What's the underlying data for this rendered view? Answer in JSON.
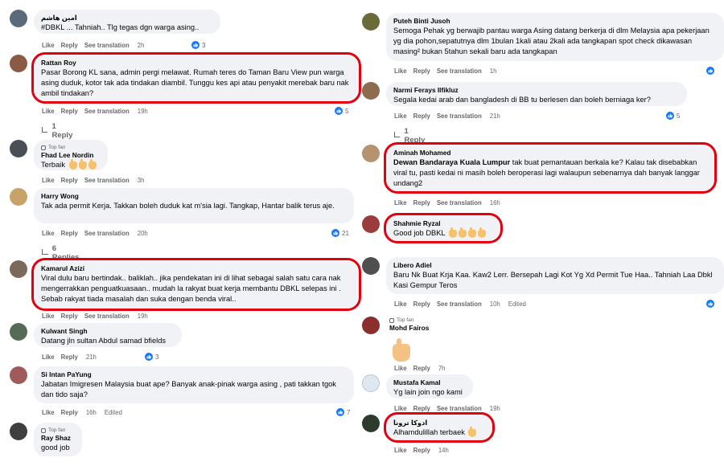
{
  "left": [
    {
      "name": "امين هاشم",
      "text": "#DBKL ... Tahniah.. Tlg tegas dgn warga asing..",
      "topfan": "",
      "time": "2h",
      "edited": "",
      "reactions": "3",
      "highlight": false,
      "replies": ""
    },
    {
      "name": "Rattan Roy",
      "text": "Pasar Borong KL sana, admin pergi melawat. Rumah teres do Taman Baru View pun warga asing duduk, kotor tak ada tindakan diambil. Tunggu kes api atau penyakit merebak baru nak ambil tindakan?",
      "topfan": "",
      "time": "19h",
      "edited": "",
      "reactions": "5",
      "highlight": true,
      "replies": "1 Reply"
    },
    {
      "name": "Fhad Lee Nordin",
      "text": "Terbaik",
      "topfan": "Top fan",
      "time": "3h",
      "edited": "",
      "reactions": "",
      "highlight": false,
      "replies": ""
    },
    {
      "name": "Harry Wong",
      "text": "Tak ada permit Kerja. Takkan boleh duduk kat m'sia lagi. Tangkap, Hantar balik terus aje.",
      "topfan": "",
      "time": "20h",
      "edited": "",
      "reactions": "21",
      "highlight": false,
      "replies": "6 Replies"
    },
    {
      "name": "Kamarul Azizi",
      "text": "Viral dulu baru bertindak.. baliklah.. jika pendekatan ini di lihat sebagai salah satu cara nak mengerrakkan penguatkuasaan.. mudah la rakyat buat kerja membantu DBKL selepas ini . Sebab rakyat tiada masalah dan suka dengan benda viral..",
      "topfan": "",
      "time": "19h",
      "edited": "",
      "reactions": "",
      "highlight": true,
      "replies": ""
    },
    {
      "name": "Kulwant Singh",
      "text": "Datang jln sultan Abdul samad bfields",
      "topfan": "",
      "time": "21h",
      "edited": "",
      "reactions": "3",
      "highlight": false,
      "replies": ""
    },
    {
      "name": "Si Intan PaYung",
      "text": "Jabatan Imigresen Malaysia buat ape? Banyak anak-pinak warga asing , pati takkan tgok dan tido saja?",
      "topfan": "",
      "time": "16h",
      "edited": "Edited",
      "reactions": "7",
      "highlight": false,
      "replies": ""
    },
    {
      "name": "Ray Shaz",
      "text": "good job",
      "topfan": "Top fan",
      "time": "",
      "edited": "",
      "reactions": "",
      "highlight": false,
      "replies": ""
    }
  ],
  "right": [
    {
      "name": "Puteh Binti Jusoh",
      "text": "Semoga Pehak yg berwajib pantau warga Asing datang berkerja di dlm Melaysia apa pekerjaan yg dia pohon,sepatutnya dlm 1bulan 1kali atau 2kali ada tangkapan spot check dikawasan masing² bukan 5tahun sekali baru ada tangkapan",
      "topfan": "",
      "time": "1h",
      "edited": "",
      "reactions": "",
      "highlight": false,
      "replies": ""
    },
    {
      "name": "Narmi Ferays Ilfikluz",
      "text": "Segala kedai arab dan bangladesh di BB tu berlesen dan boleh berniaga ker?",
      "topfan": "",
      "time": "21h",
      "edited": "",
      "reactions": "5",
      "highlight": false,
      "replies": "1 Reply"
    },
    {
      "name": "Aminah Mohamed",
      "text_bold": "Dewan Bandaraya Kuala Lumpur",
      "text": " tak buat pemantauan berkala ke? Kalau tak disebabkan viral tu, pasti kedai ni masih boleh beroperasi lagi walaupun sebenarnya dah banyak langgar undang2",
      "topfan": "",
      "time": "16h",
      "edited": "",
      "reactions": "",
      "highlight": true,
      "replies": ""
    },
    {
      "name": "Shahmie Ryzal",
      "text": "Good job DBKL",
      "topfan": "",
      "time": "",
      "edited": "",
      "reactions": "",
      "highlight": true,
      "replies": ""
    },
    {
      "name": "Libero Adiel",
      "text": "Baru Nk Buat Krja Kaa. Kaw2 Lerr. Bersepah Lagi Kot Yg Xd Permit Tue Haa.. Tahniah Laa Dbkl Kasi Gempur Teros",
      "topfan": "",
      "time": "10h",
      "edited": "Edited",
      "reactions": "",
      "highlight": false,
      "replies": ""
    },
    {
      "name": "Mohd Fairos",
      "text": "",
      "topfan": "Top fan",
      "time": "7h",
      "edited": "",
      "reactions": "",
      "highlight": false,
      "replies": ""
    },
    {
      "name": "Mustafa Kamal",
      "text": "Yg lain join ngo kami",
      "topfan": "",
      "time": "19h",
      "edited": "",
      "reactions": "",
      "highlight": false,
      "replies": ""
    },
    {
      "name": "ادوكا ترونا",
      "text": "Alhamdulillah terbaek",
      "topfan": "",
      "time": "14h",
      "edited": "",
      "reactions": "",
      "highlight": true,
      "replies": ""
    }
  ],
  "actions": {
    "like": "Like",
    "reply": "Reply",
    "translate": "See translation"
  },
  "colors": {
    "highlight": "#e3000f",
    "like_blue": "#1877f2",
    "bubble": "#f0f2f5"
  }
}
